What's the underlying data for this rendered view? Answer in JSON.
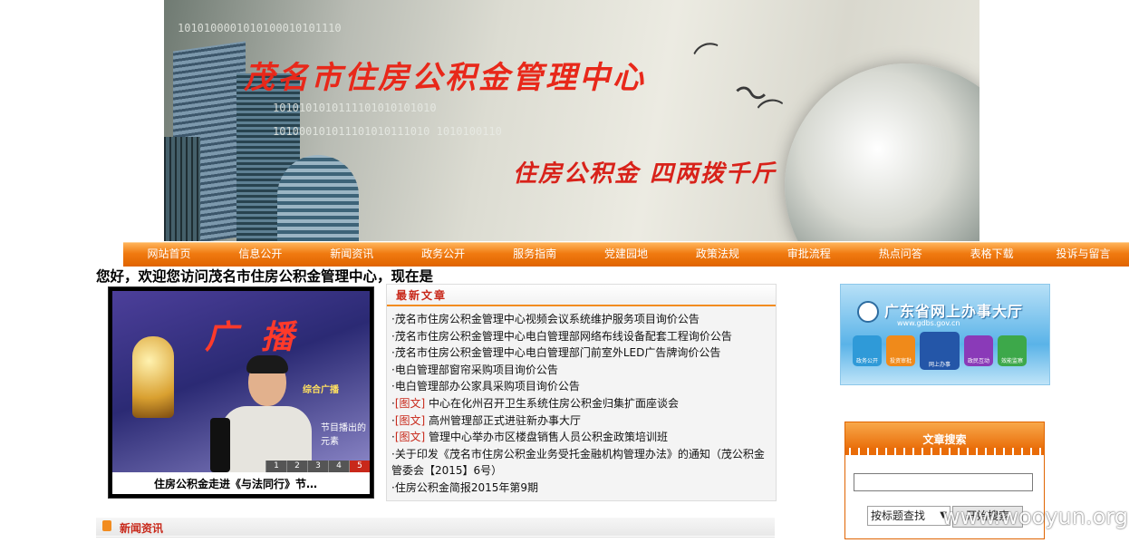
{
  "banner": {
    "title": "茂名市住房公积金管理中心",
    "slogan": "住房公积金 四两拨千斤",
    "binary_1": "1010100001010100010101110",
    "binary_2": "1010101010111101010101010",
    "binary_3": "101000101011101010111010 1010100110"
  },
  "nav": {
    "items": [
      "网站首页",
      "信息公开",
      "新闻资讯",
      "政务公开",
      "服务指南",
      "党建园地",
      "政策法规",
      "审批流程",
      "热点问答",
      "表格下载",
      "投诉与留言"
    ]
  },
  "welcome": "您好，欢迎您访问茂名市住房公积金管理中心，现在是",
  "slideshow": {
    "caption": "住房公积金走进《与法同行》节…",
    "pages": [
      "1",
      "2",
      "3",
      "4",
      "5"
    ],
    "active_page": "5",
    "guang_text": "广播",
    "sign_1": "综合广播",
    "sign_2": "节目播出的元素"
  },
  "latest": {
    "title": "最新文章",
    "items": [
      {
        "tag": "",
        "text": "茂名市住房公积金管理中心视频会议系统维护服务项目询价公告"
      },
      {
        "tag": "",
        "text": "茂名市住房公积金管理中心电白管理部网络布线设备配套工程询价公告"
      },
      {
        "tag": "",
        "text": "茂名市住房公积金管理中心电白管理部门前室外LED广告牌询价公告"
      },
      {
        "tag": "",
        "text": "电白管理部窗帘采购项目询价公告"
      },
      {
        "tag": "",
        "text": "电白管理部办公家具采购项目询价公告"
      },
      {
        "tag": "[图文]",
        "text": "中心在化州召开卫生系统住房公积金归集扩面座谈会"
      },
      {
        "tag": "[图文]",
        "text": "高州管理部正式进驻新办事大厅"
      },
      {
        "tag": "[图文]",
        "text": "管理中心举办市区楼盘销售人员公积金政策培训班"
      },
      {
        "tag": "",
        "text": "关于印发《茂名市住房公积金业务受托金融机构管理办法》的通知（茂公积金管委会【2015】6号）"
      },
      {
        "tag": "",
        "text": "住房公积金简报2015年第9期"
      }
    ]
  },
  "news": {
    "title": "新闻资讯"
  },
  "gd_ad": {
    "title": "广东省网上办事大厅",
    "url": "www.gdbs.gov.cn",
    "icons": [
      {
        "label": "政务公开",
        "icon": "person-icon",
        "color": "#2f9ad8"
      },
      {
        "label": "投资审批",
        "icon": "person-icon",
        "color": "#f08a1a"
      },
      {
        "label": "网上办事",
        "icon": "person-icon",
        "color": "#2456a8"
      },
      {
        "label": "政民互动",
        "icon": "person-icon",
        "color": "#8a3ab8"
      },
      {
        "label": "效能监察",
        "icon": "person-icon",
        "color": "#3da84a"
      }
    ]
  },
  "search": {
    "title": "文章搜索",
    "input_value": "",
    "select_value": "按标题查找",
    "button_label": "开始搜索"
  },
  "watermark": "www.wooyun.org",
  "colors": {
    "nav_orange": "#f07a10",
    "title_red": "#c8281a",
    "banner_title_red": "#e8281a"
  }
}
